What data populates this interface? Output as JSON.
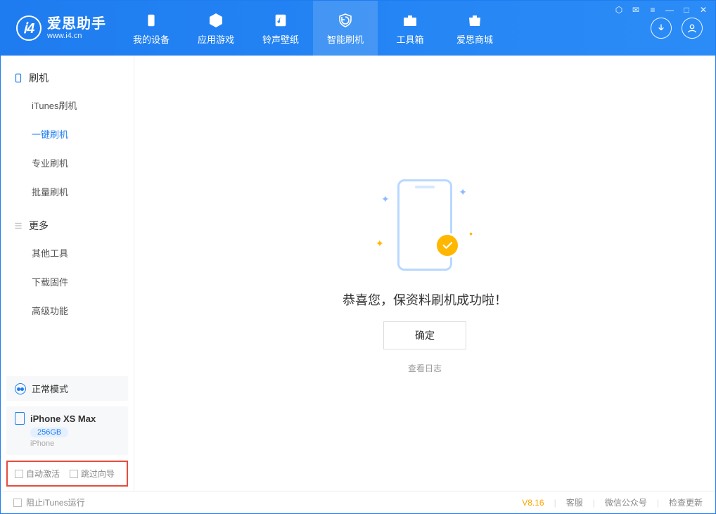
{
  "app": {
    "title": "爱思助手",
    "subtitle": "www.i4.cn"
  },
  "tabs": {
    "device": "我的设备",
    "apps": "应用游戏",
    "ringtones": "铃声壁纸",
    "flash": "智能刷机",
    "toolbox": "工具箱",
    "store": "爱思商城"
  },
  "sidebar": {
    "section1": {
      "title": "刷机"
    },
    "items1": [
      {
        "label": "iTunes刷机"
      },
      {
        "label": "一键刷机"
      },
      {
        "label": "专业刷机"
      },
      {
        "label": "批量刷机"
      }
    ],
    "section2": {
      "title": "更多"
    },
    "items2": [
      {
        "label": "其他工具"
      },
      {
        "label": "下载固件"
      },
      {
        "label": "高级功能"
      }
    ],
    "mode_label": "正常模式",
    "device": {
      "name": "iPhone XS Max",
      "storage": "256GB",
      "type": "iPhone"
    },
    "cb_auto_activate": "自动激活",
    "cb_skip_guide": "跳过向导"
  },
  "main": {
    "success_text": "恭喜您，保资料刷机成功啦！",
    "ok_button": "确定",
    "view_log": "查看日志"
  },
  "footer": {
    "block_itunes": "阻止iTunes运行",
    "version": "V8.16",
    "support": "客服",
    "wechat": "微信公众号",
    "check_update": "检查更新"
  }
}
